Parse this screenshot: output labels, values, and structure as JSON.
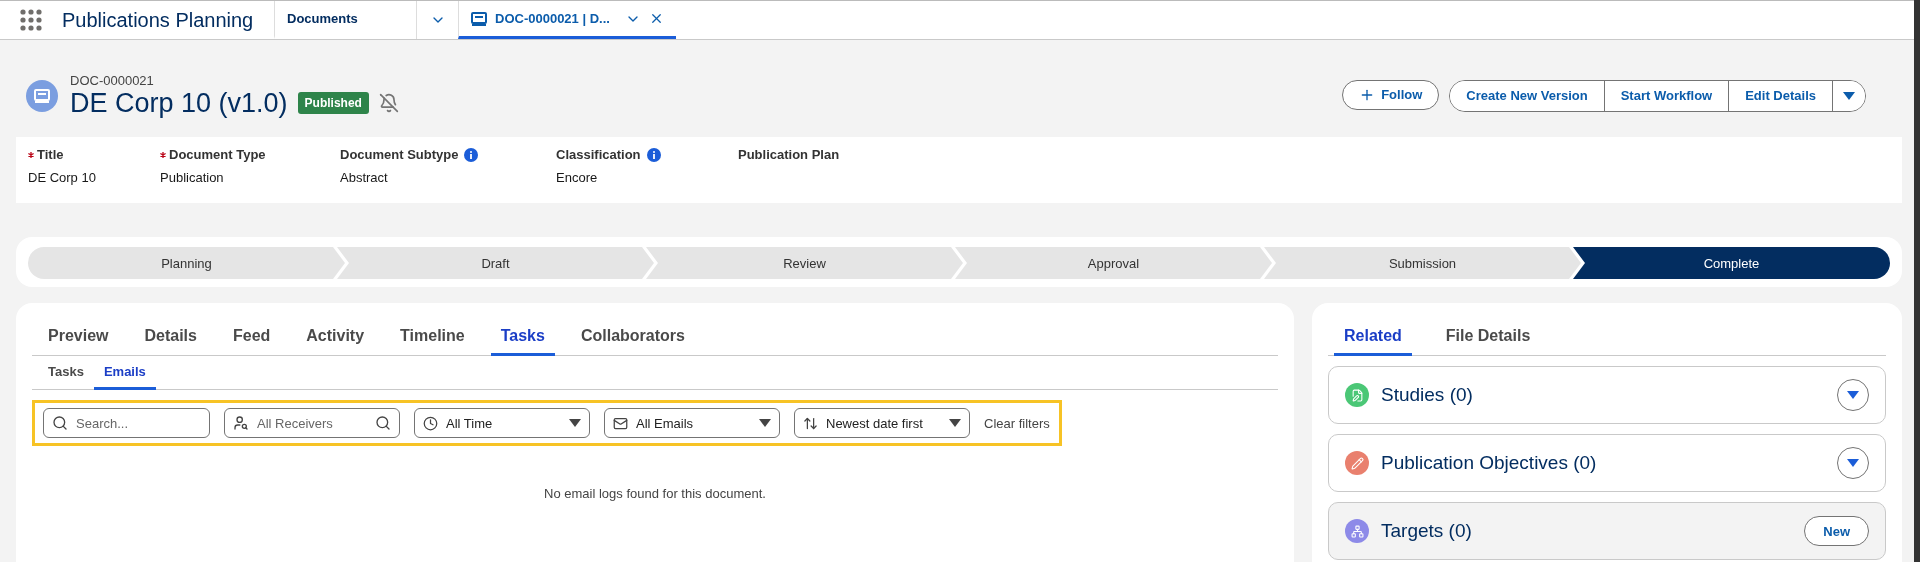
{
  "app": {
    "title": "Publications Planning"
  },
  "nav_tabs": [
    {
      "label": "Documents",
      "kind": "list",
      "selected": false
    },
    {
      "label": "DOC-0000021 | D...",
      "kind": "record",
      "selected": true
    }
  ],
  "record": {
    "number": "DOC-0000021",
    "title": "DE Corp 10 (v1.0)",
    "status": "Published",
    "follow": "Follow",
    "actions": [
      "Create New Version",
      "Start Workflow",
      "Edit Details"
    ]
  },
  "fields": [
    {
      "label": "Title",
      "value": "DE Corp 10",
      "required": true,
      "info": false
    },
    {
      "label": "Document Type",
      "value": "Publication",
      "required": true,
      "info": false
    },
    {
      "label": "Document Subtype",
      "value": "Abstract",
      "required": false,
      "info": true
    },
    {
      "label": "Classification",
      "value": "Encore",
      "required": false,
      "info": true
    },
    {
      "label": "Publication Plan",
      "required": false,
      "info": false
    }
  ],
  "path": [
    {
      "label": "Planning",
      "selected": false
    },
    {
      "label": "Draft",
      "selected": false
    },
    {
      "label": "Review",
      "selected": false
    },
    {
      "label": "Approval",
      "selected": false
    },
    {
      "label": "Submission",
      "selected": false
    },
    {
      "label": "Complete",
      "selected": true
    }
  ],
  "main_tabs": [
    {
      "label": "Preview",
      "selected": false
    },
    {
      "label": "Details",
      "selected": false
    },
    {
      "label": "Feed",
      "selected": false
    },
    {
      "label": "Activity",
      "selected": false
    },
    {
      "label": "Timeline",
      "selected": false
    },
    {
      "label": "Tasks",
      "selected": true
    },
    {
      "label": "Collaborators",
      "selected": false
    }
  ],
  "sub_tabs": [
    {
      "label": "Tasks",
      "selected": false
    },
    {
      "label": "Emails",
      "selected": true
    }
  ],
  "filters": {
    "search": {
      "placeholder": "Search..."
    },
    "receivers": {
      "placeholder": "All Receivers"
    },
    "time": {
      "value": "All Time"
    },
    "emails": {
      "value": "All Emails"
    },
    "sort": {
      "value": "Newest date first"
    },
    "clear": "Clear filters"
  },
  "empty_message": "No email logs found for this document.",
  "side_tabs": [
    {
      "label": "Related",
      "selected": true
    },
    {
      "label": "File Details",
      "selected": false
    }
  ],
  "related": [
    {
      "title": "Studies (0)",
      "color": "#4bc776",
      "kind": "expand"
    },
    {
      "title": "Publication Objectives (0)",
      "color": "#e9806e",
      "kind": "expand"
    },
    {
      "title": "Targets (0)",
      "color": "#8d8ae8",
      "kind": "new",
      "action": "New"
    }
  ]
}
